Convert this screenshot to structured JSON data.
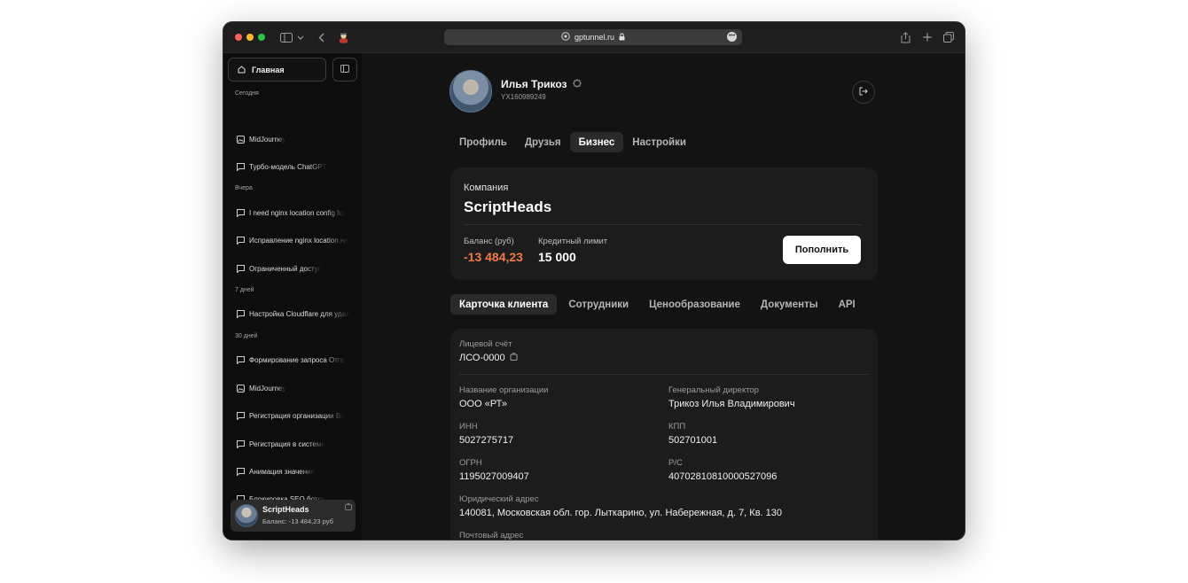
{
  "browser": {
    "url": "gptunnel.ru"
  },
  "sidebar": {
    "home_label": "Главная",
    "sections": [
      {
        "label": "Сегодня",
        "items": [
          {
            "label": "MidJourney",
            "icon": "image-icon"
          },
          {
            "label": "Турбо-модель ChatGPT",
            "icon": "chat-icon"
          }
        ]
      },
      {
        "label": "Вчера",
        "items": [
          {
            "label": "I need nginx location config for",
            "icon": "chat-icon"
          },
          {
            "label": "Исправление nginx location на",
            "icon": "chat-icon"
          },
          {
            "label": "Ограниченный доступ",
            "icon": "chat-icon"
          }
        ]
      },
      {
        "label": "7 дней",
        "items": [
          {
            "label": "Настройка Cloudflare для удал",
            "icon": "chat-icon"
          }
        ]
      },
      {
        "label": "30 дней",
        "items": [
          {
            "label": "Формирование запроса Отпр",
            "icon": "chat-icon"
          },
          {
            "label": "MidJourney",
            "icon": "image-icon"
          },
          {
            "label": "Регистрация организации Вл",
            "icon": "chat-icon"
          },
          {
            "label": "Регистрация в системе",
            "icon": "chat-icon"
          },
          {
            "label": "Анимация значения",
            "icon": "chat-icon"
          },
          {
            "label": "Блокировка SEO ботов",
            "icon": "chat-icon"
          }
        ]
      }
    ],
    "account": {
      "name": "ScriptHeads",
      "balance_text": "Баланс: -13 484,23 руб"
    }
  },
  "profile": {
    "name": "Илья Трикоз",
    "id": "YX160989249"
  },
  "tabs": [
    {
      "label": "Профиль",
      "active": false
    },
    {
      "label": "Друзья",
      "active": false
    },
    {
      "label": "Бизнес",
      "active": true
    },
    {
      "label": "Настройки",
      "active": false
    }
  ],
  "company": {
    "label": "Компания",
    "name": "ScriptHeads",
    "balance_label": "Баланс (руб)",
    "balance": "-13 484,23",
    "credit_label": "Кредитный лимит",
    "credit": "15 000",
    "topup_label": "Пополнить"
  },
  "subtabs": [
    {
      "label": "Карточка клиента",
      "active": true
    },
    {
      "label": "Сотрудники",
      "active": false
    },
    {
      "label": "Ценообразование",
      "active": false
    },
    {
      "label": "Документы",
      "active": false
    },
    {
      "label": "API",
      "active": false
    }
  ],
  "client": {
    "account_label": "Лицевой счёт",
    "account_value": "ЛСО-0000",
    "org_name_label": "Название организации",
    "org_name": "ООО «РТ»",
    "director_label": "Генеральный директор",
    "director": "Трикоз Илья Владимирович",
    "inn_label": "ИНН",
    "inn": "5027275717",
    "kpp_label": "КПП",
    "kpp": "502701001",
    "ogrn_label": "ОГРН",
    "ogrn": "1195027009407",
    "rs_label": "Р/С",
    "rs": "40702810810000527096",
    "legal_address_label": "Юридический адрес",
    "legal_address": "140081, Московская обл. гор. Лыткарино, ул. Набережная, д. 7, Кв. 130",
    "postal_address_label": "Почтовый адрес"
  },
  "colors": {
    "negative_balance": "#f07a45",
    "background": "#131313",
    "card": "#1c1c1c"
  }
}
